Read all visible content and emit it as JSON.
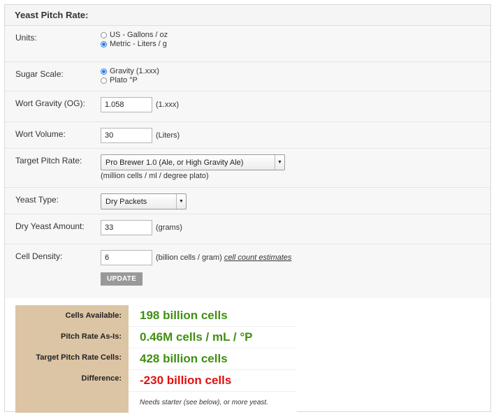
{
  "title": "Yeast Pitch Rate:",
  "form": {
    "units": {
      "label": "Units:",
      "options": [
        "US - Gallons / oz",
        "Metric - Liters / g"
      ],
      "selected_index": 1
    },
    "sugar_scale": {
      "label": "Sugar Scale:",
      "options": [
        "Gravity (1.xxx)",
        "Plato °P"
      ],
      "selected_index": 0
    },
    "wort_gravity": {
      "label": "Wort Gravity (OG):",
      "value": "1.058",
      "unit": "(1.xxx)"
    },
    "wort_volume": {
      "label": "Wort Volume:",
      "value": "30",
      "unit": "(Liters)"
    },
    "target_pitch_rate": {
      "label": "Target Pitch Rate:",
      "selected": "Pro Brewer 1.0 (Ale, or High Gravity Ale)",
      "note": "(million cells / ml / degree plato)"
    },
    "yeast_type": {
      "label": "Yeast Type:",
      "selected": "Dry Packets"
    },
    "dry_yeast_amount": {
      "label": "Dry Yeast Amount:",
      "value": "33",
      "unit": "(grams)"
    },
    "cell_density": {
      "label": "Cell Density:",
      "value": "6",
      "unit": "(billion cells / gram)",
      "link": "cell count estimates"
    },
    "update_label": "UPDATE"
  },
  "results": {
    "rows": [
      {
        "label": "Cells Available:",
        "value": "198 billion cells",
        "status": "positive"
      },
      {
        "label": "Pitch Rate As-Is:",
        "value": "0.46M cells / mL / °P",
        "status": "positive"
      },
      {
        "label": "Target Pitch Rate Cells:",
        "value": "428 billion cells",
        "status": "positive"
      },
      {
        "label": "Difference:",
        "value": "-230 billion cells",
        "status": "negative"
      }
    ],
    "note": "Needs starter (see below), or more yeast."
  },
  "colors": {
    "positive": "#3f8f12",
    "negative": "#e01010",
    "label_panel": "#dcc5a4",
    "radio_accent": "#2a7ae2"
  }
}
